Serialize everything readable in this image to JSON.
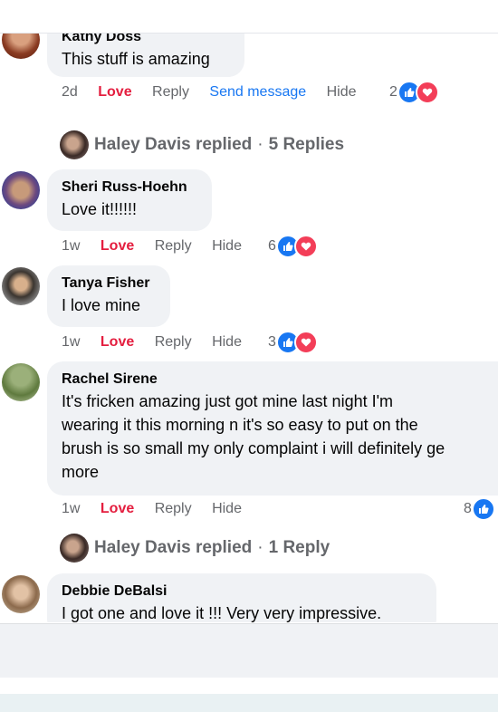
{
  "comments": [
    {
      "author": "Kathy Doss",
      "text": "This stuff is amazing",
      "time": "2d",
      "love": "Love",
      "reply": "Reply",
      "send": "Send message",
      "hide": "Hide",
      "count": "2"
    },
    {
      "author": "Sheri Russ-Hoehn",
      "text": "Love it!!!!!!",
      "time": "1w",
      "love": "Love",
      "reply": "Reply",
      "hide": "Hide",
      "count": "6"
    },
    {
      "author": "Tanya Fisher",
      "text": "I love mine",
      "time": "1w",
      "love": "Love",
      "reply": "Reply",
      "hide": "Hide",
      "count": "3"
    },
    {
      "author": "Rachel Sirene",
      "text_lines": [
        "It's fricken amazing just got mine last night I'm",
        "wearing it this morning n it's so easy to put on the",
        "brush is so small my only complaint i will definitely ge",
        "more"
      ],
      "time": "1w",
      "love": "Love",
      "reply": "Reply",
      "hide": "Hide",
      "count": "8"
    },
    {
      "author": "Debbie DeBalsi",
      "text": "I got one and love it !!! Very very impressive."
    }
  ],
  "replies": [
    {
      "who": "Haley Davis replied",
      "sep": "·",
      "count_label": "5 Replies"
    },
    {
      "who": "Haley Davis replied",
      "sep": "·",
      "count_label": "1 Reply"
    }
  ],
  "colors": {
    "love": "#e41e3f",
    "link": "#1877f2",
    "muted": "#65676b",
    "bubble": "#f0f2f5"
  },
  "icons": {
    "like": "like-icon",
    "heart": "heart-icon"
  }
}
